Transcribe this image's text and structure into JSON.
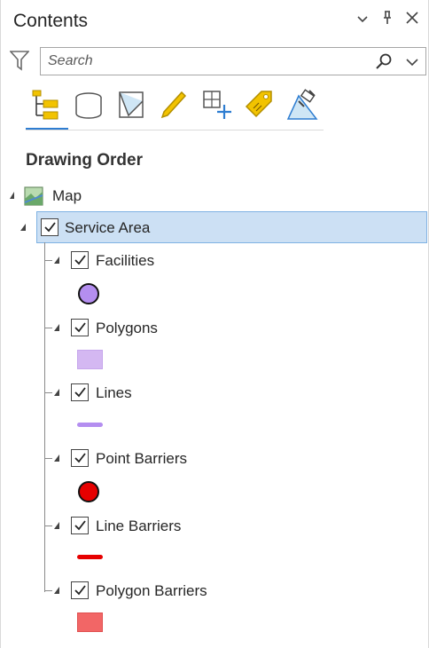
{
  "panel": {
    "title": "Contents",
    "controls": [
      "⌄",
      "📌",
      "✕"
    ]
  },
  "search": {
    "placeholder": "Search",
    "value": ""
  },
  "tabs": [
    {
      "icon": "list-by-drawing-order-icon",
      "active": true
    },
    {
      "icon": "list-by-source-icon",
      "active": false
    },
    {
      "icon": "list-by-selection-icon",
      "active": false
    },
    {
      "icon": "list-by-editing-icon",
      "active": false
    },
    {
      "icon": "list-by-snapping-icon",
      "active": false
    },
    {
      "icon": "list-by-labeling-icon",
      "active": false
    },
    {
      "icon": "list-by-perspective-imagery-icon",
      "active": false
    }
  ],
  "section": {
    "title": "Drawing Order"
  },
  "tree": {
    "map_label": "Map",
    "group_label": "Service Area",
    "layers": [
      {
        "label": "Facilities",
        "symbol": "circle",
        "color": "#b48ef0",
        "checked": true
      },
      {
        "label": "Polygons",
        "symbol": "rect",
        "color": "#d4b8f2",
        "checked": true
      },
      {
        "label": "Lines",
        "symbol": "line",
        "color": "#b48ef0",
        "checked": true
      },
      {
        "label": "Point Barriers",
        "symbol": "circle",
        "color": "#e60000",
        "checked": true
      },
      {
        "label": "Line Barriers",
        "symbol": "line",
        "color": "#e60000",
        "checked": true
      },
      {
        "label": "Polygon Barriers",
        "symbol": "rect",
        "color": "#f26666",
        "checked": true
      }
    ]
  }
}
